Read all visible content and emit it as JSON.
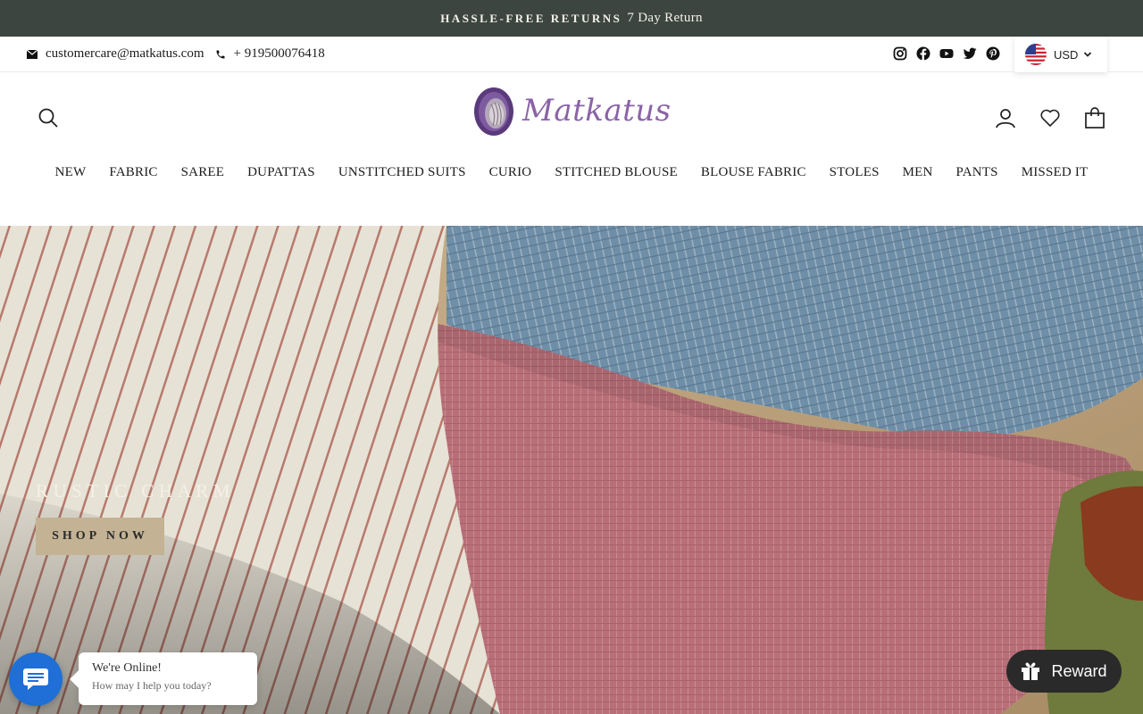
{
  "announcement": {
    "strong": "HASSLE-FREE RETURNS",
    "light": "7 Day Return"
  },
  "contact": {
    "email": "customercare@matkatus.com",
    "phone": "+ 919500076418"
  },
  "socials": [
    "instagram-icon",
    "facebook-icon",
    "youtube-icon",
    "twitter-icon",
    "pinterest-icon"
  ],
  "currency": {
    "selected": "USD"
  },
  "logo": {
    "text": "Matkatus"
  },
  "nav": {
    "items": [
      "NEW",
      "FABRIC",
      "SAREE",
      "DUPATTAS",
      "UNSTITCHED SUITS",
      "CURIO",
      "STITCHED BLOUSE",
      "BLOUSE FABRIC",
      "STOLES",
      "MEN",
      "PANTS",
      "MISSED IT"
    ]
  },
  "hero": {
    "title": "RUSTIC CHARM",
    "button": "SHOP NOW"
  },
  "chat": {
    "status": "We're Online!",
    "prompt": "How may I help you today?"
  },
  "reward": {
    "label": "Reward"
  },
  "colors": {
    "announce_bg": "#3d4540",
    "brand_purple": "#8a63a6",
    "chat_blue": "#1f6fd6",
    "shop_btn": "#c3b394"
  }
}
